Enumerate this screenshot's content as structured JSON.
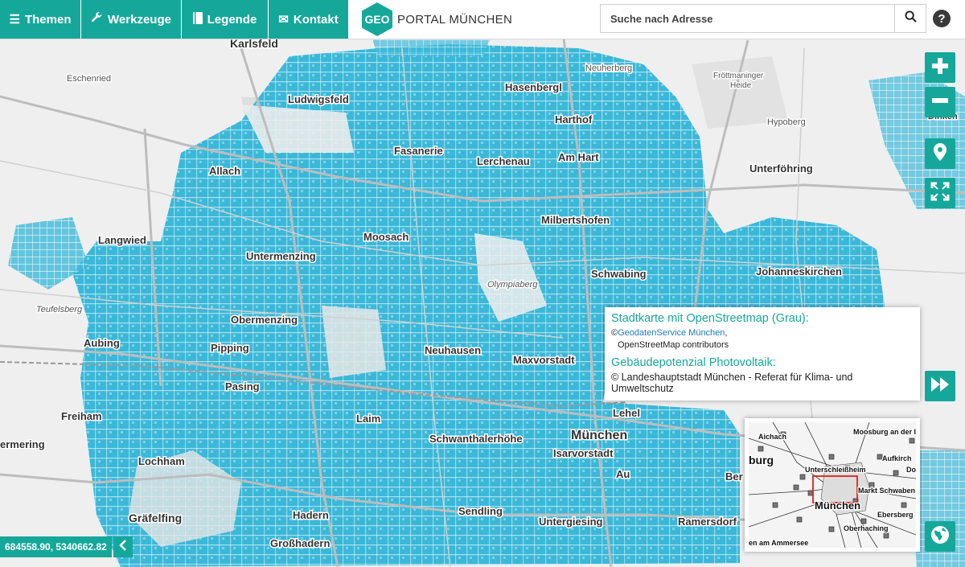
{
  "nav": [
    {
      "key": "themen",
      "label": "Themen",
      "icon": "list-icon"
    },
    {
      "key": "werkzeuge",
      "label": "Werkzeuge",
      "icon": "wrench-icon"
    },
    {
      "key": "legende",
      "label": "Legende",
      "icon": "book-icon"
    },
    {
      "key": "kontakt",
      "label": "Kontakt",
      "icon": "envelope-icon"
    }
  ],
  "logo": {
    "badge": "GEO",
    "text": "PORTAL MÜNCHEN"
  },
  "search": {
    "placeholder": "Suche nach Adresse",
    "icon": "search-icon"
  },
  "help": {
    "label": "?",
    "icon": "help-icon"
  },
  "controls": [
    {
      "key": "zoom-in",
      "icon": "plus-icon"
    },
    {
      "key": "zoom-out",
      "icon": "minus-icon"
    },
    {
      "key": "locate",
      "icon": "location-pin-icon"
    },
    {
      "key": "fullscreen",
      "icon": "fullscreen-icon"
    },
    {
      "key": "forward",
      "icon": "fast-forward-icon"
    },
    {
      "key": "basemap",
      "icon": "globe-icon"
    }
  ],
  "attribution": {
    "heading1": "Stadtkarte mit OpenStreetmap (Grau):",
    "copy_prefix": "©",
    "link": "GeodatenService München",
    "line2": ", ",
    "line3": "OpenStreetMap contributors",
    "heading2": "Gebäudepotenzial Photovoltaik:",
    "line4": "© Landeshauptstadt München - Referat für Klima- und Umweltschutz"
  },
  "coordinates": {
    "value": "684558.90, 5340662.82",
    "toggle_icon": "chevron-left-icon"
  },
  "colors": {
    "accent": "#15a89a",
    "solar_layer": "#3bb8d8",
    "roads": "#c4c4c4",
    "map_bg": "#efefef"
  },
  "map_labels": {
    "karlsfeld": "Karlsfeld",
    "eschenried": "Eschenried",
    "ludwigsfeld": "Ludwigsfeld",
    "hasenbergl": "Hasenbergl",
    "harthof": "Harthof",
    "neuherberg": "Neuherberg",
    "froettmaninger": "Fröttmaninger",
    "heide": "Heide",
    "hypoberg": "Hypoberg",
    "fasanerie": "Fasanerie",
    "am_hart": "Am Hart",
    "lerchenau": "Lerchenau",
    "unterfoehring": "Unterföhring",
    "allach": "Allach",
    "milbertshofen": "Milbertshofen",
    "langwied": "Langwied",
    "moosach": "Moosach",
    "untermenzing": "Untermenzing",
    "johanneskirchen": "Johanneskirchen",
    "schwabing": "Schwabing",
    "olympiaberg": "Olympiaberg",
    "teufelsberg": "Teufelsberg",
    "obermenzing": "Obermenzing",
    "aubing": "Aubing",
    "pipping": "Pipping",
    "neuhausen": "Neuhausen",
    "maxvorstadt": "Maxvorstadt",
    "pasing": "Pasing",
    "freiham": "Freiham",
    "laim": "Laim",
    "lehel": "Lehel",
    "muenchen": "München",
    "schwanthalerhoehe": "Schwanthalerhöhe",
    "isarvorstadt": "Isarvorstadt",
    "aermering": "ermering",
    "lochham": "Lochham",
    "graefelfing": "Gräfelfing",
    "hadern": "Hadern",
    "sendling": "Sendling",
    "untergiesing": "Untergiesing",
    "ramersdorf": "Ramersdorf",
    "grosshadern": "Großhadern",
    "au": "Au",
    "berg": "Ber",
    "dinken": "Dinken",
    "germ_left": "Germ"
  },
  "overview_labels": {
    "aichach": "Aichach",
    "moosburg": "Moosburg an der I",
    "burg": "burg",
    "unterschleissheim": "Unterschleißheim",
    "aufkirch": "Aufkirch",
    "do": "Do",
    "schwaben": "Markt Schwaben",
    "muenchen": "München",
    "ebersberg": "Ebersberg",
    "oberhaching": "Oberhaching",
    "ammersee": "en am Ammersee"
  }
}
